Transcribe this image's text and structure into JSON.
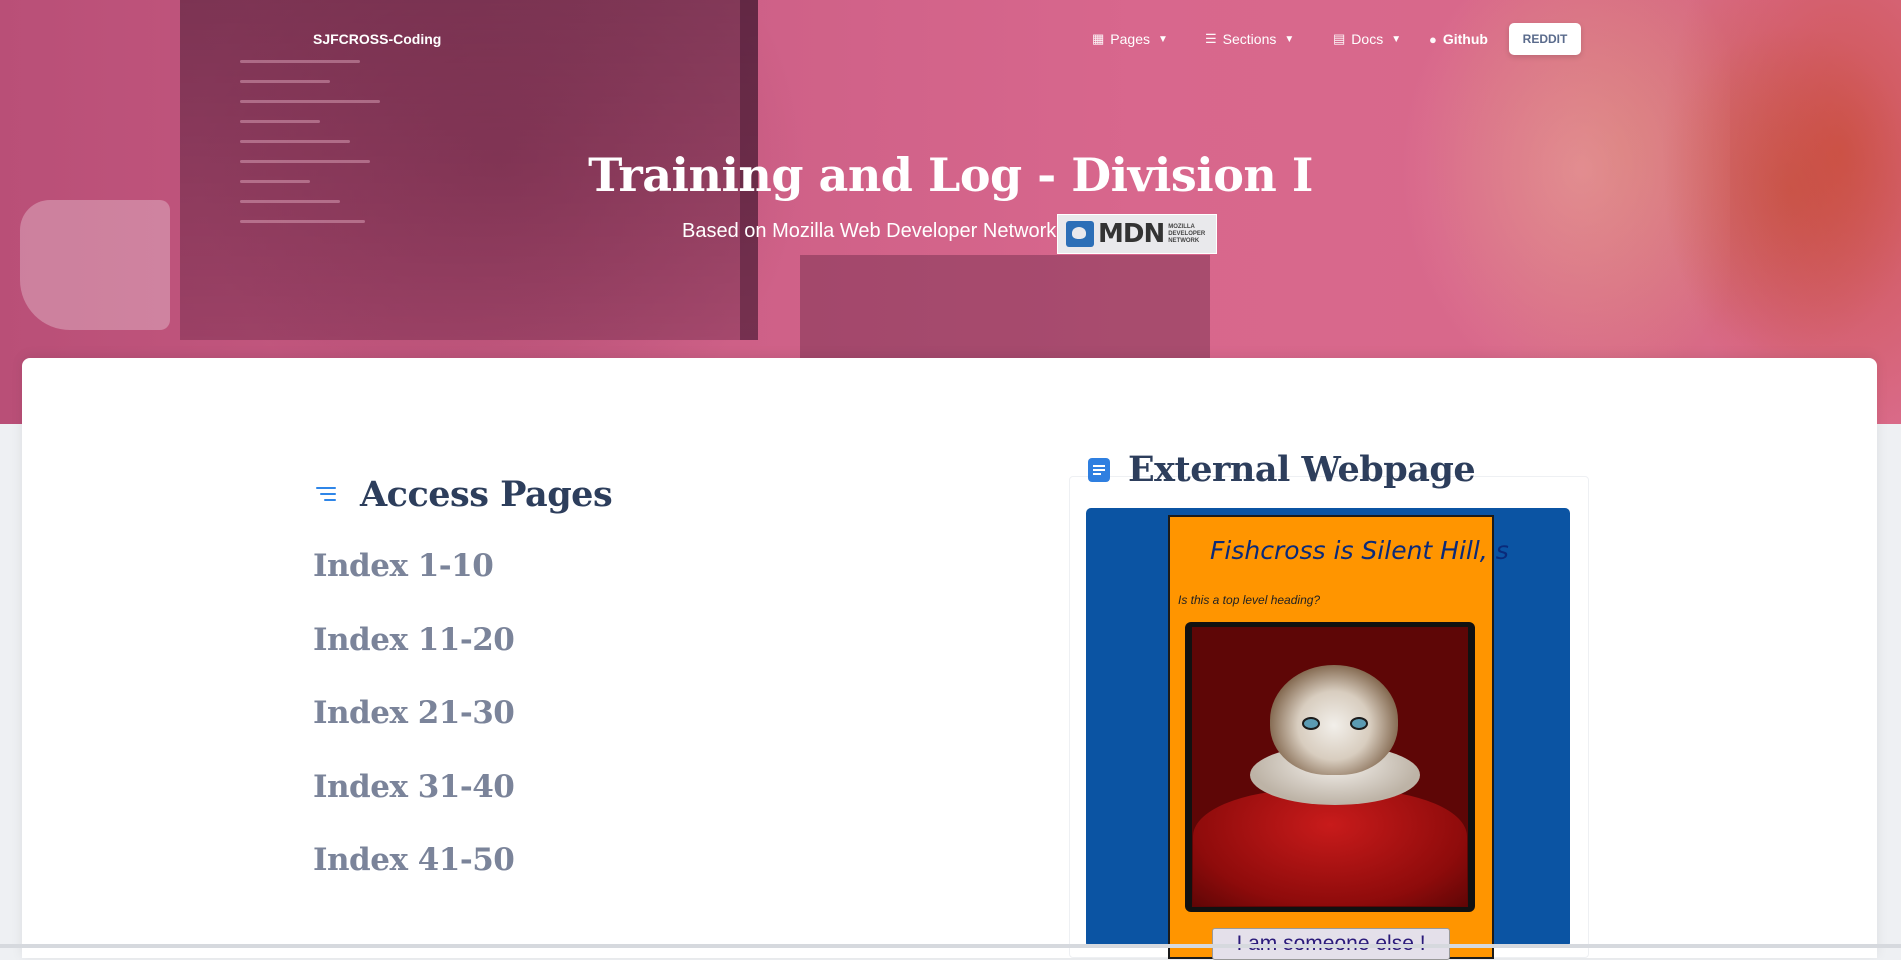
{
  "navbar": {
    "brand": "SJFCROSS-Coding",
    "items": [
      {
        "label": "Pages",
        "icon": "grid-icon",
        "dropdown": true
      },
      {
        "label": "Sections",
        "icon": "list-icon",
        "dropdown": true
      },
      {
        "label": "Docs",
        "icon": "book-icon",
        "dropdown": true
      },
      {
        "label": "Github",
        "icon": "github-icon",
        "dropdown": false
      }
    ],
    "button_label": "REDDIT"
  },
  "hero": {
    "title": "Training and Log - Division I",
    "subtitle": "Based on Mozilla Web Developer Network",
    "badge": {
      "text": "MDN",
      "small_lines": [
        "MOZILLA",
        "DEVELOPER",
        "NETWORK"
      ]
    }
  },
  "access": {
    "title": "Access Pages",
    "links": [
      "Index 1-10",
      "Index 11-20",
      "Index 21-30",
      "Index 31-40",
      "Index 41-50"
    ]
  },
  "external": {
    "title": "External Webpage",
    "page_heading": "Fishcross is Silent Hill, s",
    "page_text": "Is this a top level heading?",
    "page_button": "I am someone else !"
  },
  "colors": {
    "accent": "#2f86e8",
    "heading": "#2d3e5c",
    "link": "#7b849a",
    "hero_tint": "#cc5f86"
  }
}
